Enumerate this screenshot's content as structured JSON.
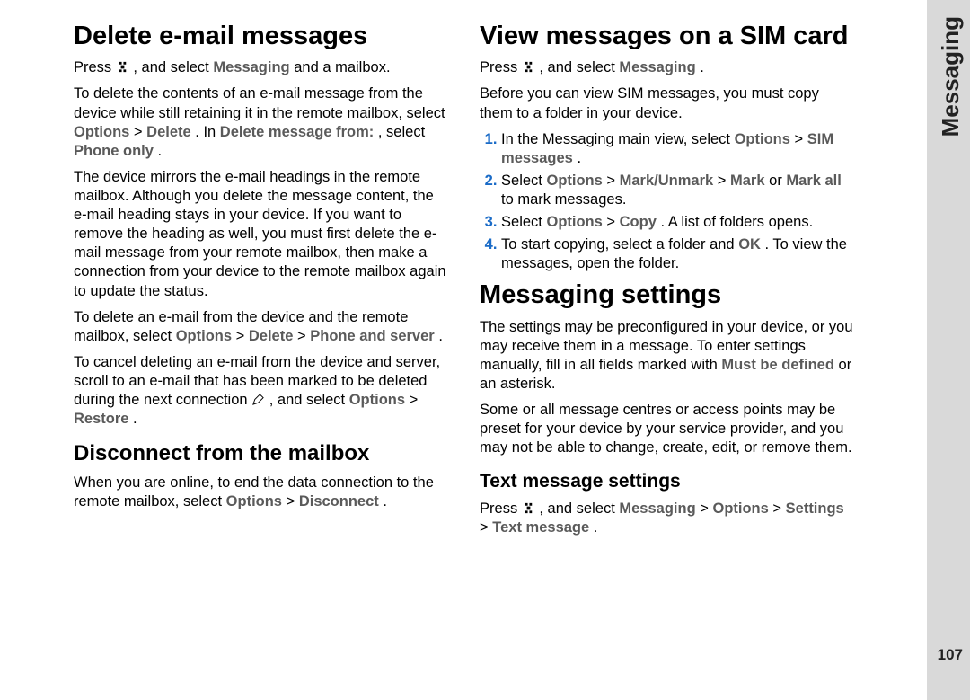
{
  "side_tab": {
    "label": "Messaging",
    "page_number": "107"
  },
  "left": {
    "h1": "Delete e-mail messages",
    "p1_a": "Press ",
    "p1_b": " , and select ",
    "p1_c": "Messaging",
    "p1_d": " and a mailbox.",
    "p2_a": "To delete the contents of an e-mail message from the device while still retaining it in the remote mailbox, select ",
    "p2_b": "Options",
    "p2_c": " > ",
    "p2_d": "Delete",
    "p2_e": ". In ",
    "p2_f": "Delete message from:",
    "p2_g": ", select ",
    "p2_h": "Phone only",
    "p2_i": ".",
    "p3": "The device mirrors the e-mail headings in the remote mailbox. Although you delete the message content, the e-mail heading stays in your device. If you want to remove the heading as well, you must first delete the e-mail message from your remote mailbox, then make a connection from your device to the remote mailbox again to update the status.",
    "p4_a": "To delete an e-mail from the device and the remote mailbox, select ",
    "p4_b": "Options",
    "p4_c": " > ",
    "p4_d": "Delete",
    "p4_e": " > ",
    "p4_f": "Phone and server",
    "p4_g": ".",
    "p5_a": "To cancel deleting an e-mail from the device and server, scroll to an e-mail that has been marked to be deleted during the next connection ",
    "p5_b": ", and select ",
    "p5_c": "Options",
    "p5_d": " > ",
    "p5_e": "Restore",
    "p5_f": ".",
    "h2": "Disconnect from the mailbox",
    "p6_a": "When you are online, to end the data connection to the remote mailbox, select ",
    "p6_b": "Options",
    "p6_c": " > ",
    "p6_d": "Disconnect",
    "p6_e": "."
  },
  "right": {
    "h1": "View messages on a SIM card",
    "p1_a": "Press ",
    "p1_b": " , and select ",
    "p1_c": "Messaging",
    "p1_d": ".",
    "p2": "Before you can view SIM messages, you must copy them to a folder in your device.",
    "li1_a": "In the Messaging main view, select ",
    "li1_b": "Options",
    "li1_c": " > ",
    "li1_d": "SIM messages",
    "li1_e": ".",
    "li2_a": "Select ",
    "li2_b": "Options",
    "li2_c": " > ",
    "li2_d": "Mark/Unmark",
    "li2_e": " > ",
    "li2_f": "Mark",
    "li2_g": " or ",
    "li2_h": "Mark all",
    "li2_i": " to mark messages.",
    "li3_a": "Select ",
    "li3_b": "Options",
    "li3_c": " > ",
    "li3_d": "Copy",
    "li3_e": ". A list of folders opens.",
    "li4_a": "To start copying, select a folder and ",
    "li4_b": "OK",
    "li4_c": ". To view the messages, open the folder.",
    "h1b": "Messaging settings",
    "p3_a": "The settings may be preconfigured in your device, or you may receive them in a message. To enter settings manually, fill in all fields marked with ",
    "p3_b": "Must be defined",
    "p3_c": " or an asterisk.",
    "p4": "Some or all message centres or access points may be preset for your device by your service provider, and you may not be able to change, create, edit, or remove them.",
    "h3": "Text message settings",
    "p5_a": "Press ",
    "p5_b": " , and select ",
    "p5_c": "Messaging",
    "p5_d": " > ",
    "p5_e": "Options",
    "p5_f": " > ",
    "p5_g": "Settings",
    "p5_h": " > ",
    "p5_i": "Text message",
    "p5_j": "."
  }
}
